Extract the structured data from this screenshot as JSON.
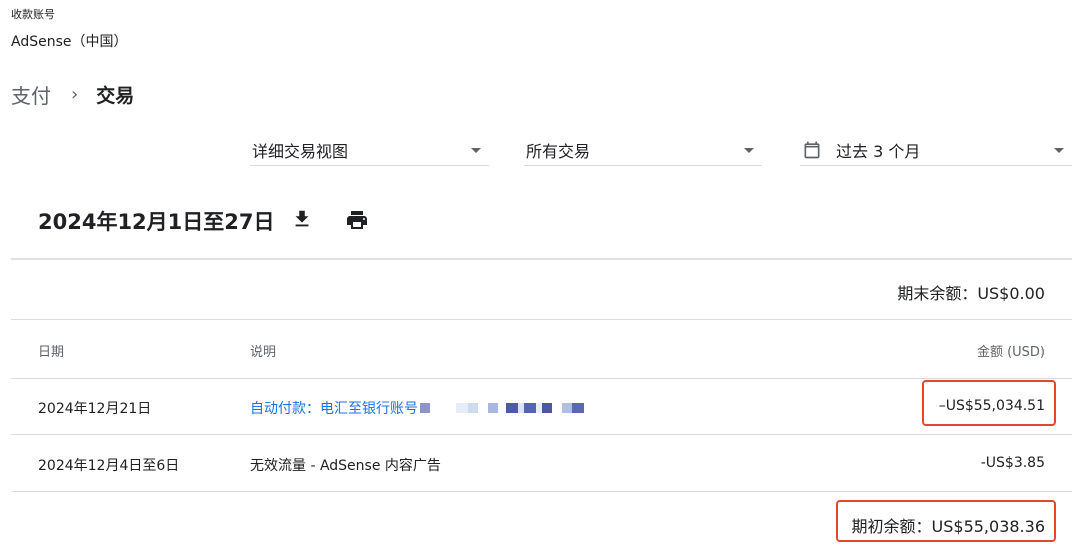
{
  "account": {
    "label": "收款账号",
    "name": "AdSense（中国）"
  },
  "breadcrumb": {
    "parent": "支付",
    "separator": "›",
    "current": "交易"
  },
  "filters": {
    "view": "详细交易视图",
    "type": "所有交易",
    "date": "过去 3 个月"
  },
  "period": {
    "title": "2024年12月1日至27日"
  },
  "closing_balance": "期末余额：US$0.00",
  "table": {
    "headers": {
      "date": "日期",
      "description": "说明",
      "amount": "金额 (USD)"
    },
    "rows": [
      {
        "date": "2024年12月21日",
        "description": "自动付款：电汇至银行账号",
        "amount": "–US$55,034.51"
      },
      {
        "date": "2024年12月4日至6日",
        "description": "无效流量 - AdSense 内容广告",
        "amount": "-US$3.85"
      }
    ]
  },
  "opening_balance": "期初余额：US$55,038.36",
  "colors": {
    "link": "#1a73e8",
    "highlight": "#e8462b",
    "divider": "#dadce0",
    "secondary_text": "#5f6368"
  },
  "icons": {
    "calendar": "calendar-icon",
    "download": "download-icon",
    "print": "print-icon",
    "dropdown": "dropdown-caret-icon"
  }
}
